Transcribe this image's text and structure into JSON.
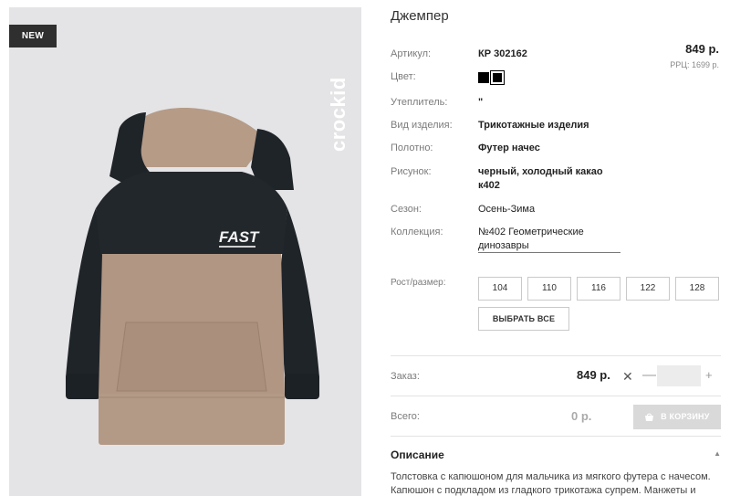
{
  "product": {
    "badge": "NEW",
    "brand": "crockid",
    "print_text": "FAST",
    "title": "Джемпер",
    "price": "849 р.",
    "rrc": "РРЦ: 1699 р."
  },
  "specs": [
    {
      "label": "Артикул:",
      "value": "КР 302162"
    },
    {
      "label": "Цвет:",
      "value": ""
    },
    {
      "label": "Утеплитель:",
      "value": "\""
    },
    {
      "label": "Вид изделия:",
      "value": "Трикотажные изделия"
    },
    {
      "label": "Полотно:",
      "value": "Футер начес"
    },
    {
      "label": "Рисунок:",
      "value": "черный, холодный какао к402"
    },
    {
      "label": "Сезон:",
      "value": "Осень-Зима"
    },
    {
      "label": "Коллекция:",
      "value": "№402 Геометрические динозавры"
    }
  ],
  "colors": [
    "#000000",
    "#000000"
  ],
  "sizes": {
    "label": "Рост/размер:",
    "options": [
      "104",
      "110",
      "116",
      "122",
      "128"
    ],
    "select_all": "ВЫБРАТЬ ВСЕ"
  },
  "order": {
    "label": "Заказ:",
    "price": "849 р.",
    "remove_symbol": "✕",
    "minus": "—",
    "plus": "+",
    "qty_value": ""
  },
  "total": {
    "label": "Всего:",
    "price": "0 р.",
    "cart_button": "В КОРЗИНУ"
  },
  "description": {
    "title": "Описание",
    "text": "Толстовка с капюшоном для мальчика из мягкого футера с начесом. Капюшон с подкладом из гладкого трикотажа супрем. Манжеты и"
  }
}
